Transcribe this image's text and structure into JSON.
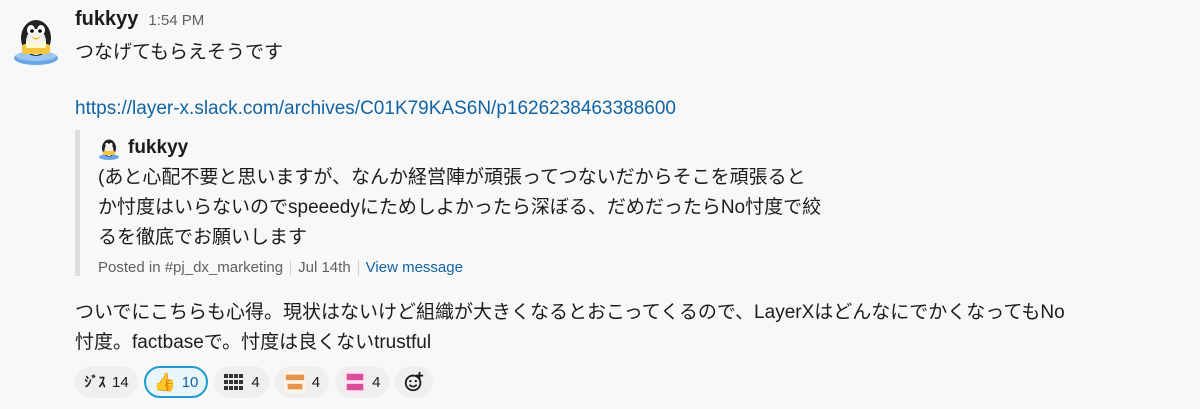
{
  "message": {
    "author": "fukkyy",
    "time": "1:54 PM",
    "line1": "つなげてもらえそうです",
    "link": "https://layer-x.slack.com/archives/C01K79KAS6N/p1626238463388600",
    "quote": {
      "author": "fukkyy",
      "text": "(あと心配不要と思いますが、なんか経営陣が頑張ってつないだからそこを頑張ると\nか忖度はいらないのでspeeedyにためしよかったら深ぼる、だめだったらNo忖度で絞\nるを徹底でお願いします",
      "channel": "Posted in #pj_dx_marketing",
      "date": "Jul 14th",
      "view": "View message"
    },
    "body": "ついでにこちらも心得。現状はないけど組織が大きくなるとおこってくるので、LayerXはどんなにでかくなってもNo\n忖度。factbaseで。忖度は良くないtrustful"
  },
  "reactions": [
    {
      "icon": "zisu-emoji",
      "label": "ｼﾞｽ",
      "count": "14",
      "color": "#1d1c1d"
    },
    {
      "icon": "thumbs-up-emoji",
      "label": "👍",
      "count": "10",
      "active": true
    },
    {
      "icon": "grid-emoji",
      "label": "",
      "count": "4"
    },
    {
      "icon": "trustful-team-emoji",
      "label": "",
      "count": "4",
      "color": "#e07a2c"
    },
    {
      "icon": "fact-base-emoji",
      "label": "",
      "count": "4",
      "color": "#d4328c"
    }
  ],
  "colors": {
    "link": "#1264a3",
    "active_border": "#1d9bd1",
    "active_bg": "#e8f5fa"
  }
}
